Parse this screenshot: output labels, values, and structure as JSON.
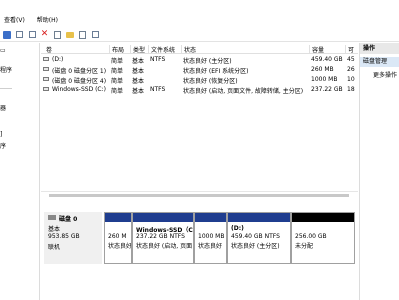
{
  "menu": [
    "查看(V)",
    "帮助(H)"
  ],
  "nav": {
    "items": [
      "程序",
      "",
      "器",
      "",
      "]",
      "序"
    ]
  },
  "volume_table": {
    "columns": [
      "卷",
      "布局",
      "类型",
      "文件系统",
      "状态",
      "容量",
      "可"
    ],
    "rows": [
      {
        "name": "(D:)",
        "layout": "简单",
        "type": "基本",
        "fs": "NTFS",
        "status": "状态良好 (主分区)",
        "capacity": "459.40 GB",
        "free": "45"
      },
      {
        "name": "(磁盘 0 磁盘分区 1)",
        "layout": "简单",
        "type": "基本",
        "fs": "",
        "status": "状态良好 (EFI 系统分区)",
        "capacity": "260 MB",
        "free": "26"
      },
      {
        "name": "(磁盘 0 磁盘分区 4)",
        "layout": "简单",
        "type": "基本",
        "fs": "",
        "status": "状态良好 (恢复分区)",
        "capacity": "1000 MB",
        "free": "10"
      },
      {
        "name": "Windows-SSD (C:)",
        "layout": "简单",
        "type": "基本",
        "fs": "NTFS",
        "status": "状态良好 (启动, 页面文件, 故障转储, 主分区)",
        "capacity": "237.22 GB",
        "free": "18"
      }
    ]
  },
  "disk": {
    "name": "磁盘 0",
    "type": "基本",
    "size": "953.85 GB",
    "status": "联机",
    "partitions": [
      {
        "title": "",
        "size": "260 M",
        "status": "状态良好"
      },
      {
        "title": "Windows-SSD（C",
        "size": "237.22 GB NTFS",
        "status": "状态良好 (启动, 页面"
      },
      {
        "title": "",
        "size": "1000 MB",
        "status": "状态良好"
      },
      {
        "title": "(D:)",
        "size": "459.40 GB NTFS",
        "status": "状态良好 (主分区)"
      },
      {
        "title": "",
        "size": "256.00 GB",
        "status": "未分配"
      }
    ]
  },
  "actions": {
    "header": "操作",
    "section": "磁盘管理",
    "more": "更多操作"
  },
  "colors": {
    "partition_bar": "#1f3d8f",
    "unallocated_bar": "#000000",
    "selection": "#dbe8f6"
  }
}
